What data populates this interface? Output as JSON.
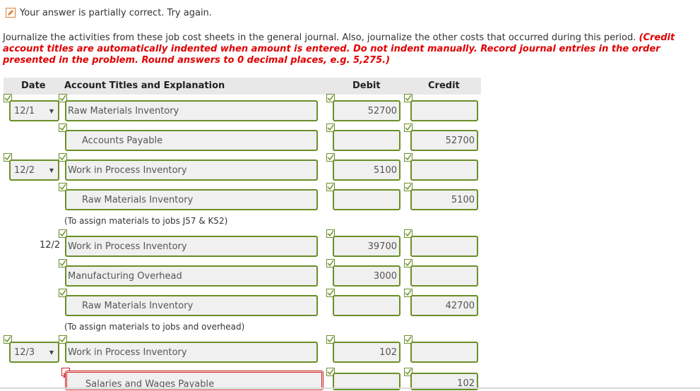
{
  "status": {
    "message": "Your answer is partially correct.  Try again.",
    "icon": "pencil-check-icon"
  },
  "instructions": {
    "text": "Journalize the activities from these job cost sheets in the general journal. Also, journalize the other costs that occurred during this period. ",
    "red_text": "(Credit account titles are automatically indented when amount is entered. Do not indent manually. Record journal entries in the order presented in the problem. Round answers to 0 decimal places, e.g. 5,275.)"
  },
  "table": {
    "headers": {
      "date": "Date",
      "account": "Account Titles and Explanation",
      "debit": "Debit",
      "credit": "Credit"
    }
  },
  "rows": [
    {
      "date": "12/1",
      "account": "Raw Materials Inventory",
      "debit": "52700",
      "credit": ""
    },
    {
      "date": "",
      "account": "Accounts Payable",
      "debit": "",
      "credit": "52700"
    },
    {
      "date": "12/2",
      "account": "Work in Process Inventory",
      "debit": "5100",
      "credit": ""
    },
    {
      "date": "",
      "account": "Raw Materials Inventory",
      "debit": "",
      "credit": "5100"
    },
    {
      "note": "(To assign materials to jobs J57 & K52)"
    },
    {
      "date": "12/2",
      "account": "Work in Process Inventory",
      "debit": "39700",
      "credit": ""
    },
    {
      "date": "",
      "account": "Manufacturing Overhead",
      "debit": "3000",
      "credit": ""
    },
    {
      "date": "",
      "account": "Raw Materials Inventory",
      "debit": "",
      "credit": "42700"
    },
    {
      "note": "(To assign materials to jobs and overhead)"
    },
    {
      "date": "12/3",
      "account": "Work in Process Inventory",
      "debit": "102",
      "credit": ""
    },
    {
      "date": "",
      "account": "Salaries and Wages Payable",
      "debit": "",
      "credit": "102"
    }
  ],
  "colors": {
    "correct": "#6a8f28",
    "incorrect": "#d02020",
    "instruction_red": "#e00000"
  }
}
